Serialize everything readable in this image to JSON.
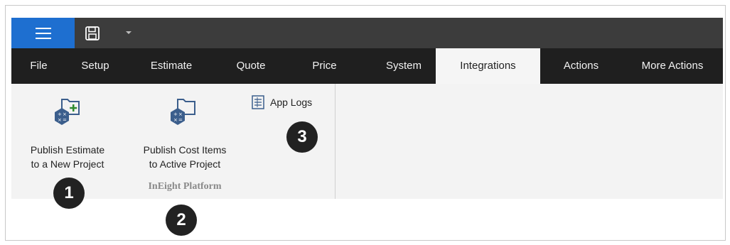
{
  "tabs": [
    "File",
    "Setup",
    "Estimate",
    "Quote",
    "Price",
    "System",
    "Integrations",
    "Actions",
    "More Actions"
  ],
  "active_tab": "Integrations",
  "ribbon": {
    "publish_estimate_line1": "Publish Estimate",
    "publish_estimate_line2": "to a New Project",
    "publish_cost_line1": "Publish Cost Items",
    "publish_cost_line2": "to Active Project",
    "app_logs": "App Logs",
    "group_label": "InEight Platform"
  },
  "callouts": [
    "1",
    "2",
    "3"
  ],
  "colors": {
    "menu_blue": "#1e6fd0",
    "title_bar": "#3c3c3c",
    "tab_bar": "#1f1f1f",
    "ribbon_bg": "#f3f3f3",
    "icon_hex": "#3b5e8c",
    "plus_green": "#2e8b2e"
  },
  "icons": [
    "hamburger-menu-icon",
    "save-icon",
    "dropdown-arrow-icon",
    "publish-new-project-icon",
    "publish-active-project-icon",
    "app-logs-icon"
  ]
}
